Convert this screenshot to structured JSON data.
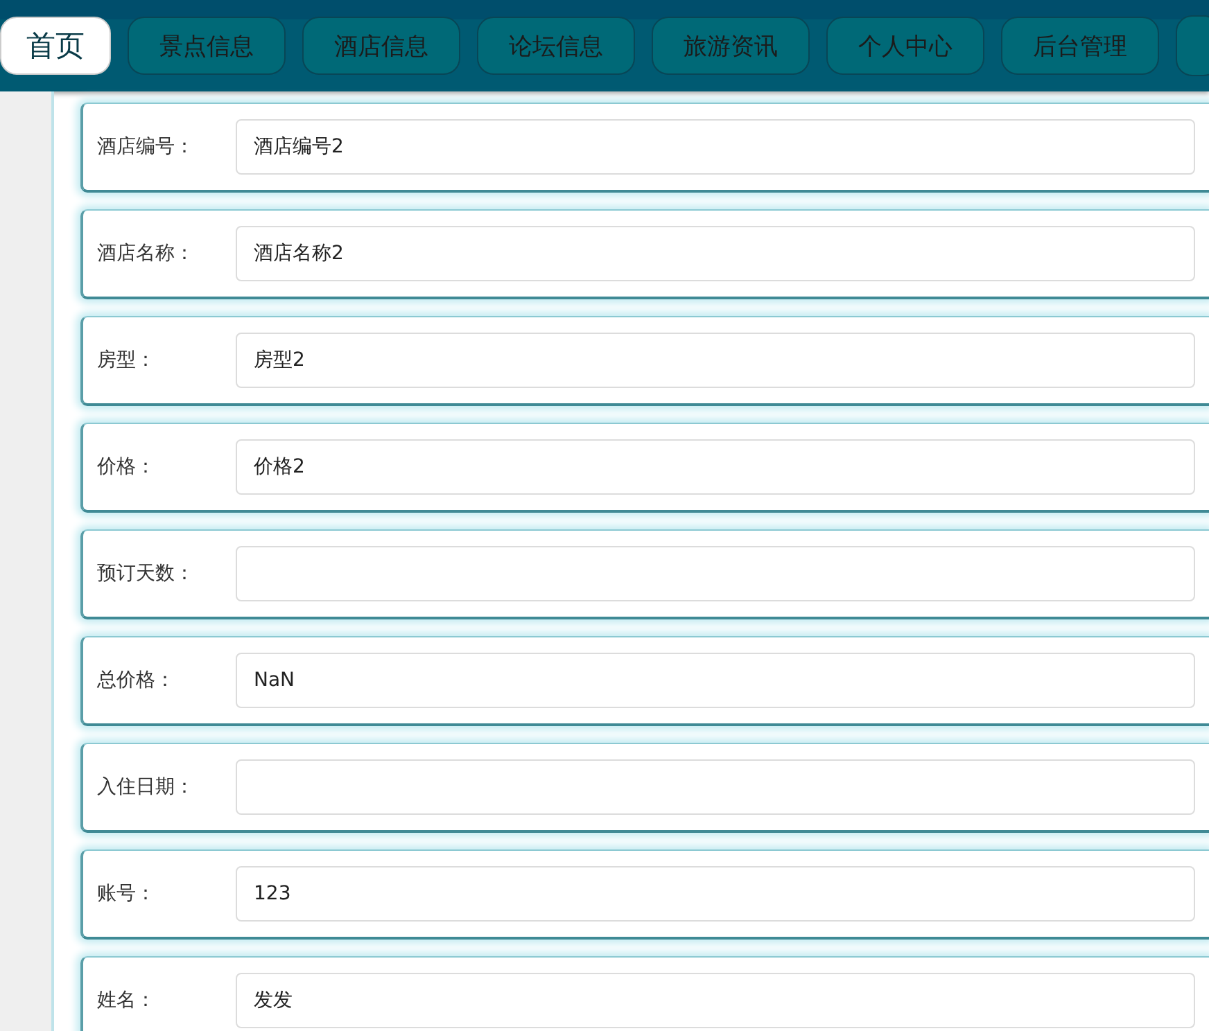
{
  "nav": {
    "items": [
      {
        "label": "首页",
        "selected": true
      },
      {
        "label": "景点信息",
        "selected": false
      },
      {
        "label": "酒店信息",
        "selected": false
      },
      {
        "label": "论坛信息",
        "selected": false
      },
      {
        "label": "旅游资讯",
        "selected": false
      },
      {
        "label": "个人中心",
        "selected": false
      },
      {
        "label": "后台管理",
        "selected": false
      }
    ]
  },
  "form": {
    "fields": [
      {
        "label": "酒店编号：",
        "value": "酒店编号2"
      },
      {
        "label": "酒店名称：",
        "value": "酒店名称2"
      },
      {
        "label": "房型：",
        "value": "房型2"
      },
      {
        "label": "价格：",
        "value": "价格2"
      },
      {
        "label": "预订天数："
      },
      {
        "label": "总价格：",
        "value": "NaN"
      },
      {
        "label": "入住日期："
      },
      {
        "label": "账号：",
        "value": "123"
      },
      {
        "label": "姓名：",
        "value": "发发"
      }
    ]
  }
}
